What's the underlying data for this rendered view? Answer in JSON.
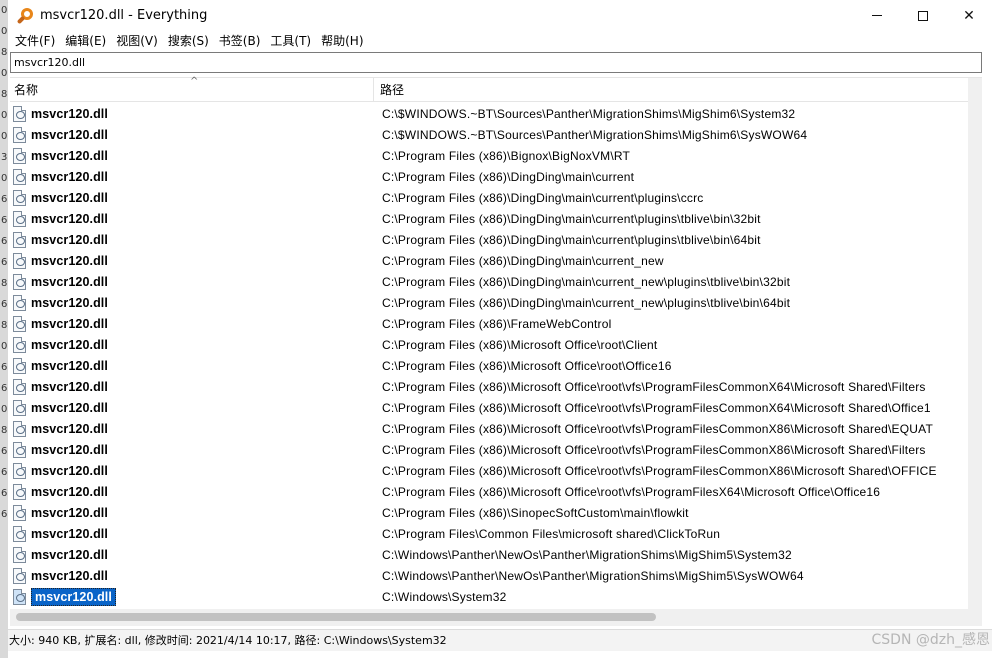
{
  "behind_window": {
    "digits": [
      "0",
      "0",
      "8",
      "0",
      "8",
      "0",
      "0",
      "3",
      "0",
      "6",
      "6",
      "6",
      "6",
      "8",
      "6",
      "8",
      "0",
      "6",
      "6",
      "0",
      "8",
      "6",
      "6",
      "6",
      "6"
    ]
  },
  "window": {
    "title": "msvcr120.dll - Everything",
    "controls": {
      "minimize": "minimize",
      "maximize": "maximize",
      "close": "✕"
    }
  },
  "menu": [
    "文件(F)",
    "编辑(E)",
    "视图(V)",
    "搜索(S)",
    "书签(B)",
    "工具(T)",
    "帮助(H)"
  ],
  "search": {
    "value": "msvcr120.dll"
  },
  "columns": {
    "name": "名称",
    "path": "路径",
    "sort_indicator": "^"
  },
  "rows": [
    {
      "name": "msvcr120.dll",
      "path": "C:\\$WINDOWS.~BT\\Sources\\Panther\\MigrationShims\\MigShim6\\System32"
    },
    {
      "name": "msvcr120.dll",
      "path": "C:\\$WINDOWS.~BT\\Sources\\Panther\\MigrationShims\\MigShim6\\SysWOW64"
    },
    {
      "name": "msvcr120.dll",
      "path": "C:\\Program Files (x86)\\Bignox\\BigNoxVM\\RT"
    },
    {
      "name": "msvcr120.dll",
      "path": "C:\\Program Files (x86)\\DingDing\\main\\current"
    },
    {
      "name": "msvcr120.dll",
      "path": "C:\\Program Files (x86)\\DingDing\\main\\current\\plugins\\ccrc"
    },
    {
      "name": "msvcr120.dll",
      "path": "C:\\Program Files (x86)\\DingDing\\main\\current\\plugins\\tblive\\bin\\32bit"
    },
    {
      "name": "msvcr120.dll",
      "path": "C:\\Program Files (x86)\\DingDing\\main\\current\\plugins\\tblive\\bin\\64bit"
    },
    {
      "name": "msvcr120.dll",
      "path": "C:\\Program Files (x86)\\DingDing\\main\\current_new"
    },
    {
      "name": "msvcr120.dll",
      "path": "C:\\Program Files (x86)\\DingDing\\main\\current_new\\plugins\\tblive\\bin\\32bit"
    },
    {
      "name": "msvcr120.dll",
      "path": "C:\\Program Files (x86)\\DingDing\\main\\current_new\\plugins\\tblive\\bin\\64bit"
    },
    {
      "name": "msvcr120.dll",
      "path": "C:\\Program Files (x86)\\FrameWebControl"
    },
    {
      "name": "msvcr120.dll",
      "path": "C:\\Program Files (x86)\\Microsoft Office\\root\\Client"
    },
    {
      "name": "msvcr120.dll",
      "path": "C:\\Program Files (x86)\\Microsoft Office\\root\\Office16"
    },
    {
      "name": "msvcr120.dll",
      "path": "C:\\Program Files (x86)\\Microsoft Office\\root\\vfs\\ProgramFilesCommonX64\\Microsoft Shared\\Filters"
    },
    {
      "name": "msvcr120.dll",
      "path": "C:\\Program Files (x86)\\Microsoft Office\\root\\vfs\\ProgramFilesCommonX64\\Microsoft Shared\\Office1"
    },
    {
      "name": "msvcr120.dll",
      "path": "C:\\Program Files (x86)\\Microsoft Office\\root\\vfs\\ProgramFilesCommonX86\\Microsoft Shared\\EQUAT"
    },
    {
      "name": "msvcr120.dll",
      "path": "C:\\Program Files (x86)\\Microsoft Office\\root\\vfs\\ProgramFilesCommonX86\\Microsoft Shared\\Filters"
    },
    {
      "name": "msvcr120.dll",
      "path": "C:\\Program Files (x86)\\Microsoft Office\\root\\vfs\\ProgramFilesCommonX86\\Microsoft Shared\\OFFICE"
    },
    {
      "name": "msvcr120.dll",
      "path": "C:\\Program Files (x86)\\Microsoft Office\\root\\vfs\\ProgramFilesX64\\Microsoft Office\\Office16"
    },
    {
      "name": "msvcr120.dll",
      "path": "C:\\Program Files (x86)\\SinopecSoftCustom\\main\\flowkit"
    },
    {
      "name": "msvcr120.dll",
      "path": "C:\\Program Files\\Common Files\\microsoft shared\\ClickToRun"
    },
    {
      "name": "msvcr120.dll",
      "path": "C:\\Windows\\Panther\\NewOs\\Panther\\MigrationShims\\MigShim5\\System32"
    },
    {
      "name": "msvcr120.dll",
      "path": "C:\\Windows\\Panther\\NewOs\\Panther\\MigrationShims\\MigShim5\\SysWOW64"
    },
    {
      "name": "msvcr120.dll",
      "path": "C:\\Windows\\System32",
      "selected": true
    }
  ],
  "status": {
    "text": "大小: 940 KB, 扩展名: dll, 修改时间: 2021/4/14 10:17, 路径: C:\\Windows\\System32"
  },
  "watermark": "CSDN @dzh_感恩"
}
